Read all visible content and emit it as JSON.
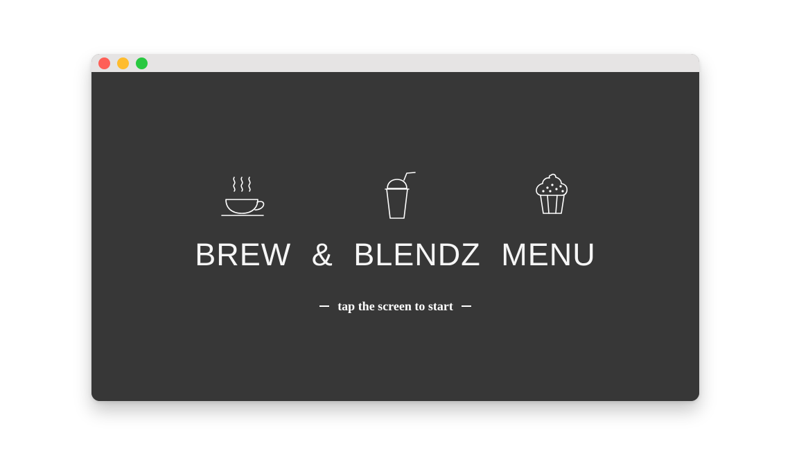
{
  "window": {
    "controls": [
      {
        "name": "close",
        "color": "#fe5f57"
      },
      {
        "name": "minimize",
        "color": "#febc2e"
      },
      {
        "name": "maximize",
        "color": "#28c840"
      }
    ]
  },
  "screen": {
    "background": "#373737",
    "icons": [
      "coffee-cup-icon",
      "smoothie-cup-icon",
      "cupcake-icon"
    ],
    "title": "BREW & BLENDZ MENU",
    "hint": "tap the screen to start"
  }
}
